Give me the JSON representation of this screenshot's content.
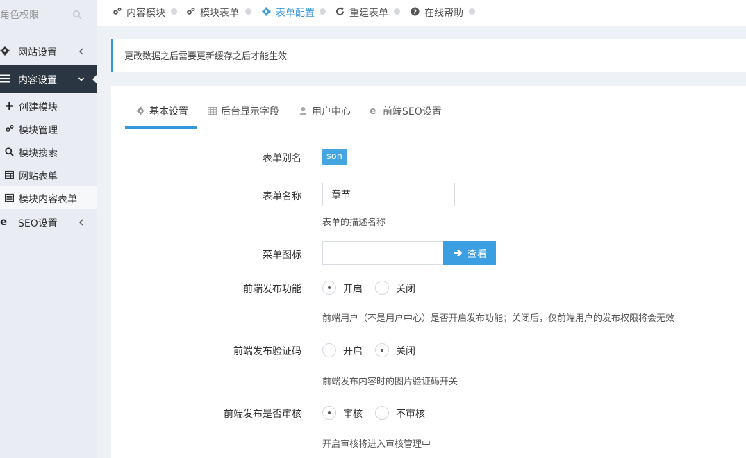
{
  "sidebar": {
    "search_placeholder": "角色权限",
    "items": [
      {
        "label": "网站设置"
      },
      {
        "label": "内容设置"
      },
      {
        "label": "SEO设置"
      }
    ],
    "subitems": [
      {
        "label": "创建模块"
      },
      {
        "label": "模块管理"
      },
      {
        "label": "模块搜索"
      },
      {
        "label": "网站表单"
      },
      {
        "label": "模块内容表单"
      }
    ]
  },
  "breadcrumb": [
    {
      "label": "内容模块"
    },
    {
      "label": "模块表单"
    },
    {
      "label": "表单配置"
    },
    {
      "label": "重建表单"
    },
    {
      "label": "在线帮助"
    }
  ],
  "notice": "更改数据之后需要更新缓存之后才能生效",
  "tabs": [
    {
      "label": "基本设置"
    },
    {
      "label": "后台显示字段"
    },
    {
      "label": "用户中心"
    },
    {
      "label": "前端SEO设置"
    }
  ],
  "form": {
    "alias_label": "表单别名",
    "alias_value": "son",
    "name_label": "表单名称",
    "name_value": "章节",
    "name_help": "表单的描述名称",
    "icon_label": "菜单图标",
    "icon_value": "",
    "view_button": "查看",
    "publish_label": "前端发布功能",
    "publish_on": "开启",
    "publish_off": "关闭",
    "publish_help": "前端用户（不是用户中心）是否开启发布功能；关闭后，仅前端用户的发布权限将会无效",
    "captcha_label": "前端发布验证码",
    "captcha_on": "开启",
    "captcha_off": "关闭",
    "captcha_help": "前端发布内容时的图片验证码开关",
    "review_label": "前端发布是否审核",
    "review_on": "审核",
    "review_off": "不审核",
    "review_help": "开启审核将进入审核管理中"
  },
  "colors": {
    "accent": "#3598dc",
    "sidebar_active_bg": "#2b3643",
    "badge_bg": "#45a5e0"
  }
}
